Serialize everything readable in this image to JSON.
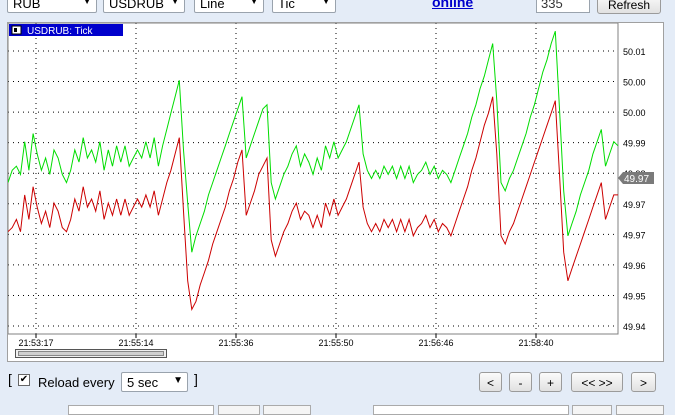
{
  "toolbar": {
    "currency_select": "RUB",
    "symbol_select": "USDRUB",
    "chart_type_select": "Line",
    "period_select": "Tic",
    "online_link": "online",
    "count_value": "335",
    "refresh_label": "Refresh"
  },
  "chart": {
    "label": "USDRUB: Tick",
    "current_price": "49.97",
    "colors": {
      "ask": "#00dd00",
      "bid": "#cc0000",
      "current_tag": "#7a7a7a"
    }
  },
  "chart_data": {
    "type": "line",
    "title": "USDRUB: Tick",
    "x_ticks": [
      "21:53:17",
      "21:55:14",
      "21:55:36",
      "21:55:50",
      "21:56:46",
      "21:58:40"
    ],
    "y_ticks": [
      "50.01",
      "50.00",
      "50.00",
      "49.99",
      "49.98",
      "49.97",
      "49.97",
      "49.96",
      "49.95",
      "49.94"
    ],
    "ylim": [
      49.937,
      50.013
    ],
    "grid": true,
    "series": [
      {
        "color": "#00dd00",
        "values": [
          49.974,
          49.977,
          49.978,
          49.976,
          49.984,
          49.977,
          49.986,
          49.981,
          49.977,
          49.98,
          49.976,
          49.982,
          49.98,
          49.976,
          49.974,
          49.977,
          49.982,
          49.979,
          49.985,
          49.98,
          49.982,
          49.979,
          49.984,
          49.977,
          49.982,
          49.978,
          49.983,
          49.979,
          49.983,
          49.978,
          49.98,
          49.982,
          49.98,
          49.984,
          49.98,
          49.985,
          49.978,
          49.983,
          49.987,
          49.991,
          49.995,
          49.999,
          49.982,
          49.969,
          49.957,
          49.961,
          49.964,
          49.967,
          49.971,
          49.974,
          49.977,
          49.98,
          49.983,
          49.986,
          49.989,
          49.992,
          49.995,
          49.98,
          49.983,
          49.986,
          49.989,
          49.992,
          49.993,
          49.974,
          49.97,
          49.973,
          49.976,
          49.978,
          49.981,
          49.983,
          49.978,
          49.981,
          49.979,
          49.976,
          49.98,
          49.977,
          49.983,
          49.98,
          49.984,
          49.98,
          49.982,
          49.984,
          49.987,
          49.99,
          49.993,
          49.981,
          49.977,
          49.975,
          49.977,
          49.975,
          49.978,
          49.976,
          49.978,
          49.975,
          49.978,
          49.975,
          49.978,
          49.974,
          49.976,
          49.977,
          49.979,
          49.976,
          49.978,
          49.975,
          49.977,
          49.976,
          49.974,
          49.977,
          49.98,
          49.983,
          49.986,
          49.99,
          49.993,
          49.997,
          50.0,
          50.004,
          50.008,
          49.994,
          49.974,
          49.972,
          49.975,
          49.977,
          49.98,
          49.983,
          49.986,
          49.99,
          49.993,
          49.997,
          50.001,
          50.004,
          50.008,
          50.011,
          49.992,
          49.972,
          49.961,
          49.964,
          49.967,
          49.971,
          49.974,
          49.977,
          49.981,
          49.984,
          49.987,
          49.978,
          49.981,
          49.984,
          49.983
        ],
        "name": ""
      },
      {
        "color": "#cc0000",
        "values": [
          49.962,
          49.963,
          49.965,
          49.962,
          49.971,
          49.965,
          49.973,
          49.968,
          49.964,
          49.967,
          49.963,
          49.969,
          49.967,
          49.963,
          49.962,
          49.965,
          49.97,
          49.967,
          49.973,
          49.968,
          49.97,
          49.967,
          49.972,
          49.965,
          49.969,
          49.966,
          49.97,
          49.966,
          49.97,
          49.966,
          49.968,
          49.97,
          49.968,
          49.971,
          49.968,
          49.972,
          49.966,
          49.97,
          49.974,
          49.977,
          49.981,
          49.985,
          49.967,
          49.95,
          49.943,
          49.945,
          49.949,
          49.952,
          49.955,
          49.959,
          49.962,
          49.965,
          49.968,
          49.972,
          49.975,
          49.979,
          49.982,
          49.966,
          49.969,
          49.972,
          49.976,
          49.978,
          49.98,
          49.96,
          49.956,
          49.959,
          49.962,
          49.964,
          49.967,
          49.969,
          49.965,
          49.967,
          49.966,
          49.963,
          49.966,
          49.963,
          49.969,
          49.966,
          49.97,
          49.966,
          49.968,
          49.97,
          49.973,
          49.976,
          49.979,
          49.968,
          49.964,
          49.962,
          49.964,
          49.962,
          49.965,
          49.963,
          49.965,
          49.962,
          49.965,
          49.962,
          49.965,
          49.961,
          49.963,
          49.964,
          49.966,
          49.963,
          49.965,
          49.962,
          49.964,
          49.963,
          49.961,
          49.964,
          49.967,
          49.97,
          49.973,
          49.977,
          49.98,
          49.984,
          49.988,
          49.991,
          49.995,
          49.981,
          49.961,
          49.959,
          49.962,
          49.964,
          49.967,
          49.97,
          49.973,
          49.976,
          49.979,
          49.982,
          49.985,
          49.988,
          49.991,
          49.994,
          49.976,
          49.957,
          49.95,
          49.953,
          49.956,
          49.959,
          49.962,
          49.965,
          49.968,
          49.971,
          49.974,
          49.965,
          49.968,
          49.971,
          49.971
        ],
        "name": ""
      }
    ]
  },
  "footer": {
    "reload_checked": "✔",
    "reload_bracket_open": "[",
    "reload_label": "Reload every",
    "reload_interval": "5 sec",
    "reload_bracket_close": "]",
    "nav_prev": "<",
    "nav_zoom_out": "-",
    "nav_zoom_in": "+",
    "nav_fit": "<< >>",
    "nav_next": ">"
  }
}
